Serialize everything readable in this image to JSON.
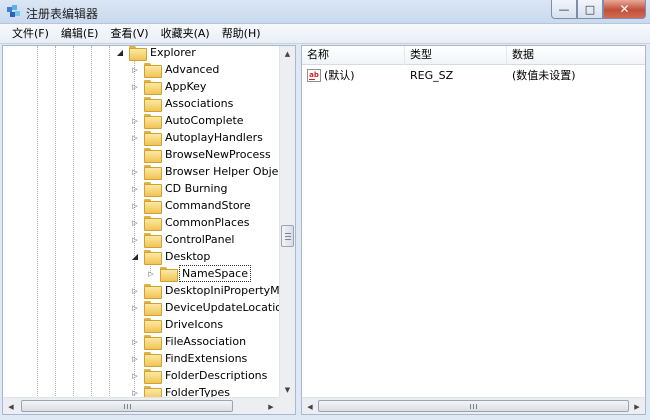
{
  "window": {
    "title": "注册表编辑器",
    "controls": {
      "minimize": "—",
      "maximize": "□",
      "close": "✕"
    }
  },
  "menu": [
    {
      "label": "文件(F)"
    },
    {
      "label": "编辑(E)"
    },
    {
      "label": "查看(V)"
    },
    {
      "label": "收藏夹(A)"
    },
    {
      "label": "帮助(H)"
    }
  ],
  "tree": {
    "parent": {
      "label": "Explorer",
      "expanded": true
    },
    "children": [
      {
        "label": "Advanced",
        "expandable": true
      },
      {
        "label": "AppKey",
        "expandable": true
      },
      {
        "label": "Associations",
        "expandable": false
      },
      {
        "label": "AutoComplete",
        "expandable": true
      },
      {
        "label": "AutoplayHandlers",
        "expandable": true
      },
      {
        "label": "BrowseNewProcess",
        "expandable": false
      },
      {
        "label": "Browser Helper Objects",
        "expandable": true
      },
      {
        "label": "CD Burning",
        "expandable": true
      },
      {
        "label": "CommandStore",
        "expandable": true
      },
      {
        "label": "CommonPlaces",
        "expandable": true
      },
      {
        "label": "ControlPanel",
        "expandable": true
      },
      {
        "label": "Desktop",
        "expandable": true,
        "expanded": true,
        "children": [
          {
            "label": "NameSpace",
            "expandable": true,
            "selected": true
          }
        ]
      },
      {
        "label": "DesktopIniPropertyMap",
        "expandable": true
      },
      {
        "label": "DeviceUpdateLocations",
        "expandable": true
      },
      {
        "label": "DriveIcons",
        "expandable": false
      },
      {
        "label": "FileAssociation",
        "expandable": true
      },
      {
        "label": "FindExtensions",
        "expandable": true
      },
      {
        "label": "FolderDescriptions",
        "expandable": true
      },
      {
        "label": "FolderTypes",
        "expandable": true
      }
    ]
  },
  "values": {
    "columns": [
      "名称",
      "类型",
      "数据"
    ],
    "rows": [
      {
        "name": "(默认)",
        "type": "REG_SZ",
        "data": "(数值未设置)",
        "icon": "string-value-icon"
      }
    ]
  },
  "scroll": {
    "tree_vertical_position": 0.5
  }
}
